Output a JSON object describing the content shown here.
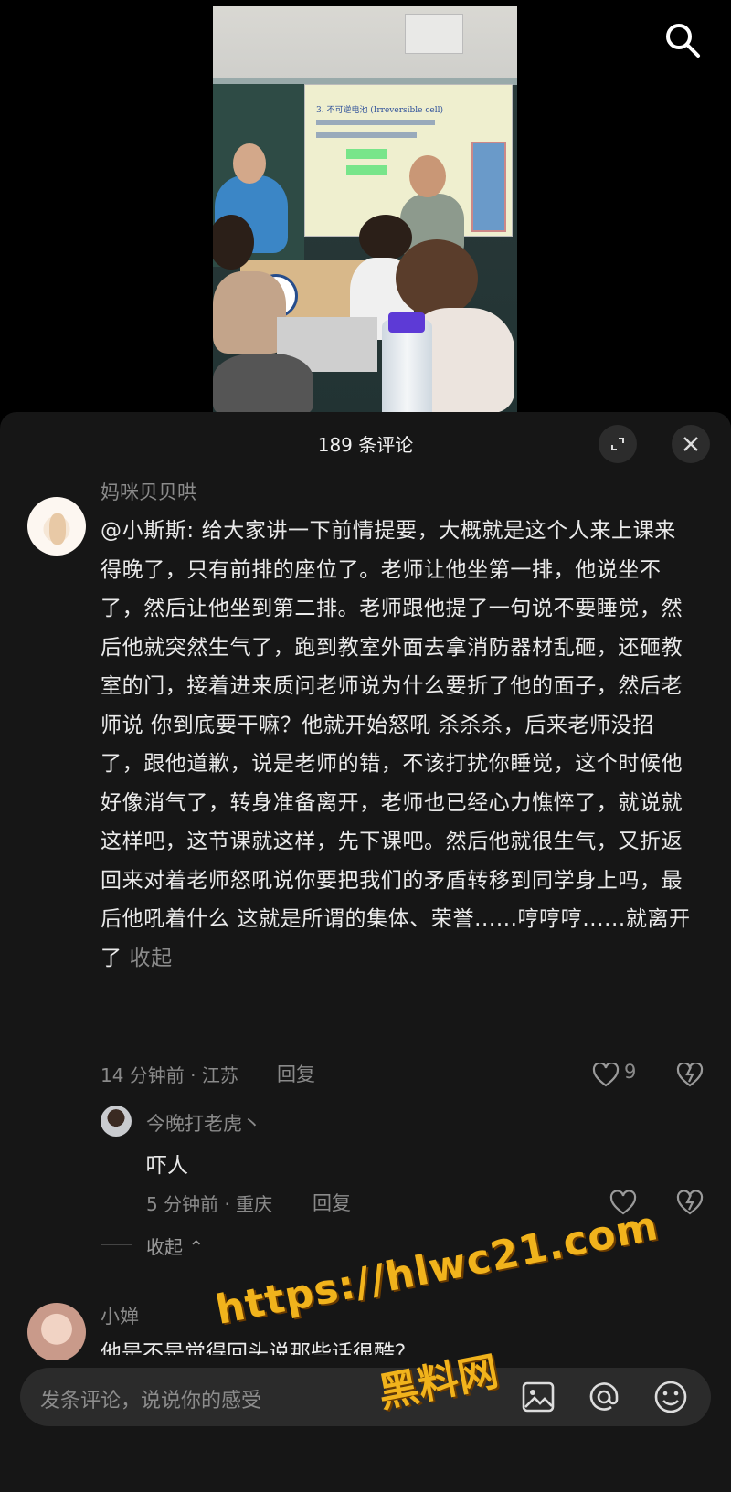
{
  "header": {
    "search_icon": "search-icon"
  },
  "comments_panel": {
    "count_label": "189 条评论",
    "expand_icon": "expand-icon",
    "close_icon": "close-icon"
  },
  "comments": [
    {
      "user": "妈咪贝贝哄",
      "text": "@小斯斯: 给大家讲一下前情提要，大概就是这个人来上课来得晚了，只有前排的座位了。老师让他坐第一排，他说坐不了，然后让他坐到第二排。老师跟他提了一句说不要睡觉，然后他就突然生气了，跑到教室外面去拿消防器材乱砸，还砸教室的门，接着进来质问老师说为什么要折了他的面子，然后老师说 你到底要干嘛？他就开始怒吼 杀杀杀，后来老师没招了，跟他道歉，说是老师的错，不该打扰你睡觉，这个时候他好像消气了，转身准备离开，老师也已经心力憔悴了，就说就这样吧，这节课就这样，先下课吧。然后他就很生气，又折返回来对着老师怒吼说你要把我们的矛盾转移到同学身上吗，最后他吼着什么 这就是所谓的集体、荣誉......哼哼哼......就离开了",
      "collapse_label": "收起",
      "time_location": "14 分钟前 · 江苏",
      "reply_label": "回复",
      "likes": "9",
      "replies": [
        {
          "user": "今晚打老虎丶",
          "text": "吓人",
          "time_location": "5 分钟前 · 重庆",
          "reply_label": "回复"
        }
      ],
      "collapse_replies_label": "收起"
    },
    {
      "user": "小婵",
      "text_partial": "他是不是觉得回头说那些话很酷？"
    }
  ],
  "composer": {
    "placeholder": "发条评论，说说你的感受",
    "icons": [
      "image-icon",
      "at-icon",
      "emoji-icon"
    ]
  },
  "watermark": {
    "line1": "https://hlwc21.com",
    "line2": "黑料网"
  },
  "colors": {
    "sheet_bg": "#161616",
    "watermark": "#f1b31c"
  }
}
